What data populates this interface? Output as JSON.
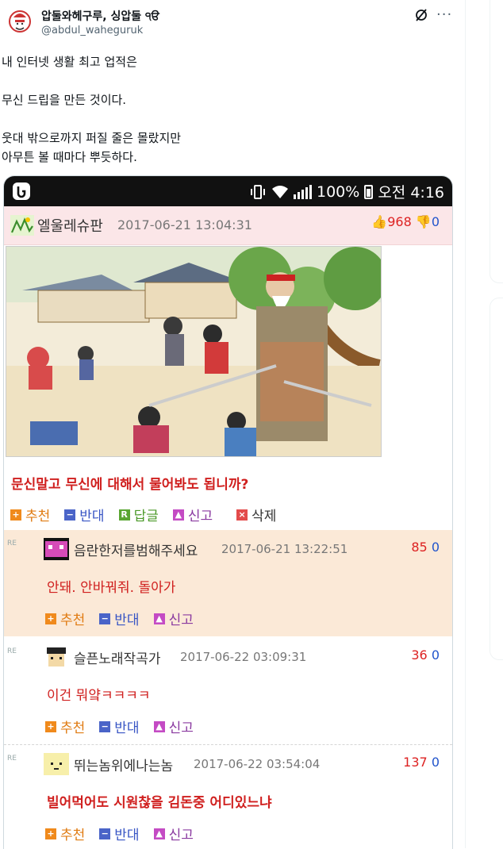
{
  "tweet": {
    "author_name": "압둘와헤구루, 싱압둘 ੧ੳ",
    "author_handle": "@abdul_waheguruk",
    "lines": [
      "내 인터넷 생활 최고 업적은",
      "",
      "무신 드립을 만든 것이다.",
      "",
      "웃대 밖으로까지 퍼질 줄은 몰랐지만",
      "아무튼 볼 때마다 뿌듯하다."
    ]
  },
  "status_bar": {
    "battery": "100%",
    "time": "오전 4:16"
  },
  "post": {
    "nick": "엘울레슈판",
    "date": "2017-06-21 13:04:31",
    "up": "968",
    "down": "0",
    "title": "문신말고 무신에 대해서 물어봐도 됩니까?",
    "actions": {
      "recommend": "추천",
      "oppose": "반대",
      "reply": "답글",
      "report": "신고",
      "delete": "삭제"
    }
  },
  "comments": [
    {
      "re": "RE",
      "nick": "음란한저를범해주세요",
      "date": "2017-06-21 13:22:51",
      "score": "85",
      "zero": "0",
      "body": "안돼. 안바꿔줘. 돌아가",
      "recommend": "추천",
      "oppose": "반대",
      "report": "신고"
    },
    {
      "re": "RE",
      "nick": "슬픈노래작곡가",
      "date": "2017-06-22 03:09:31",
      "score": "36",
      "zero": "0",
      "body": "이건 뭐얔ㅋㅋㅋㅋ",
      "recommend": "추천",
      "oppose": "반대",
      "report": "신고"
    },
    {
      "re": "RE",
      "nick": "뛰는놈위에나는놈",
      "date": "2017-06-22 03:54:04",
      "score": "137",
      "zero": "0",
      "body": "빌어먹어도 시원찮을 김돈중 어디있느냐",
      "recommend": "추천",
      "oppose": "반대",
      "report": "신고"
    }
  ],
  "colors": {
    "accent_red": "#d0201f",
    "highlight_bg": "#fbe9d7",
    "header_pink": "#fbe6e8"
  }
}
